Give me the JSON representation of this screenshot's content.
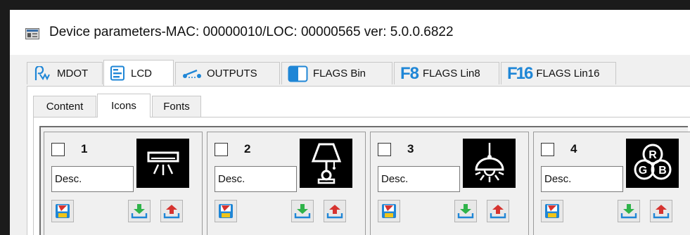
{
  "window": {
    "title": "Device parameters-MAC: 00000010/LOC: 00000565 ver: 5.0.0.6822"
  },
  "main_tabs": [
    {
      "id": "mdot",
      "label": "MDOT",
      "icon": "mdot-icon"
    },
    {
      "id": "lcd",
      "label": "LCD",
      "icon": "lcd-icon",
      "active": true
    },
    {
      "id": "outputs",
      "label": "OUTPUTS",
      "icon": "outputs-icon"
    },
    {
      "id": "flags-bin",
      "label": "FLAGS Bin",
      "icon": "flags-bin-icon"
    },
    {
      "id": "flags-lin8",
      "label": "FLAGS Lin8",
      "icon": "f8-icon",
      "icon_text": "F8"
    },
    {
      "id": "flags-lin16",
      "label": "FLAGS Lin16",
      "icon": "f16-icon",
      "icon_text": "F16"
    }
  ],
  "sub_tabs": [
    {
      "id": "content",
      "label": "Content"
    },
    {
      "id": "icons",
      "label": "Icons",
      "active": true
    },
    {
      "id": "fonts",
      "label": "Fonts"
    }
  ],
  "icon_cells": [
    {
      "number": "1",
      "desc_placeholder": "Desc.",
      "icon": "ceiling-light-icon"
    },
    {
      "number": "2",
      "desc_placeholder": "Desc.",
      "icon": "table-lamp-icon"
    },
    {
      "number": "3",
      "desc_placeholder": "Desc.",
      "icon": "pendant-lamp-icon"
    },
    {
      "number": "4",
      "desc_placeholder": "Desc.",
      "icon": "rgb-light-icon",
      "icon_letters": [
        "R",
        "G",
        "B"
      ]
    }
  ],
  "colors": {
    "accent_blue": "#1f86d6",
    "tab_border": "#c8c8c8",
    "panel_bg": "#f0f0f0",
    "download_green": "#2fb34a",
    "upload_red": "#d6332f"
  }
}
